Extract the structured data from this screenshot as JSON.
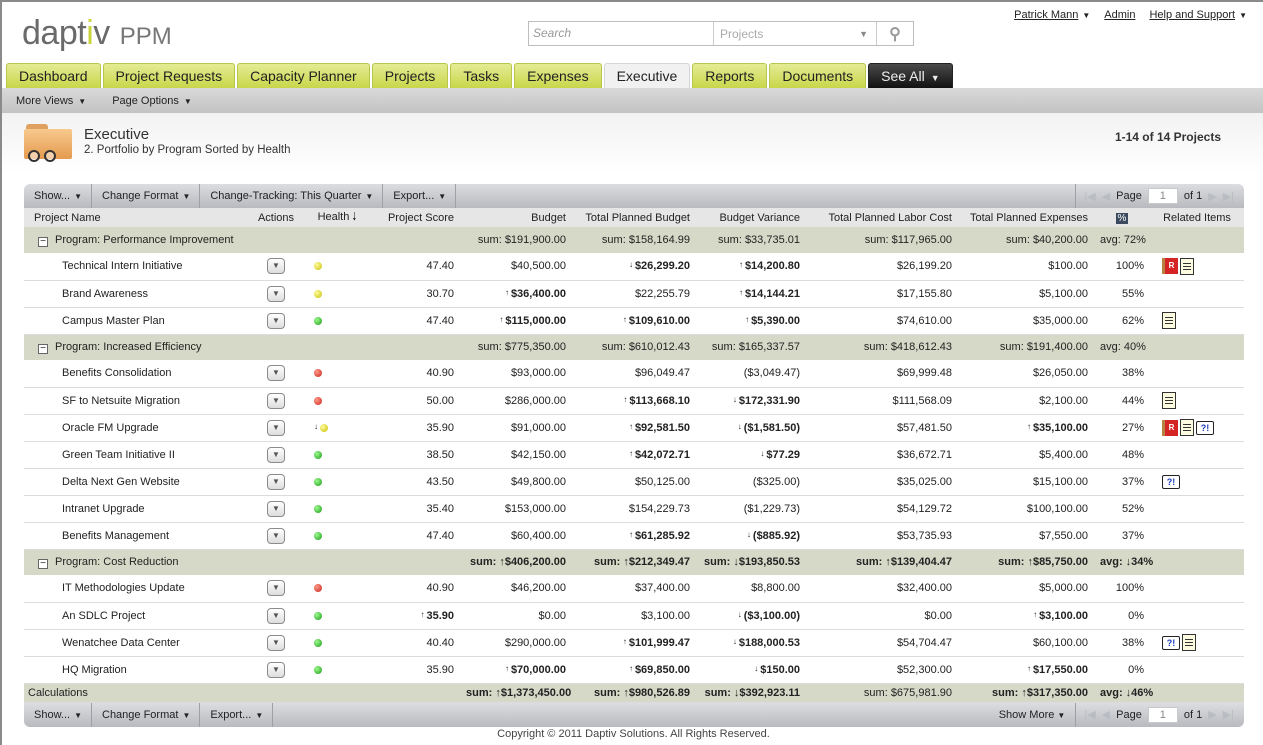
{
  "app": {
    "brand": "daptiv",
    "product": "PPM"
  },
  "search": {
    "placeholder": "Search",
    "scope": "Projects"
  },
  "toplinks": {
    "user": "Patrick Mann",
    "admin": "Admin",
    "help": "Help and Support"
  },
  "tabs": [
    {
      "label": "Dashboard"
    },
    {
      "label": "Project Requests"
    },
    {
      "label": "Capacity Planner"
    },
    {
      "label": "Projects"
    },
    {
      "label": "Tasks"
    },
    {
      "label": "Expenses"
    },
    {
      "label": "Executive",
      "active": true
    },
    {
      "label": "Reports"
    },
    {
      "label": "Documents"
    },
    {
      "label": "See All"
    }
  ],
  "subnav": {
    "more_views": "More Views",
    "page_options": "Page Options"
  },
  "page": {
    "title": "Executive",
    "subtitle": "2. Portfolio by Program Sorted by Health",
    "count": "1-14 of 14 Projects"
  },
  "toolbar": {
    "show": "Show...",
    "change_format": "Change Format",
    "change_tracking": "Change-Tracking: This Quarter",
    "export": "Export...",
    "show_more": "Show More",
    "page_label": "Page",
    "page_value": "1",
    "of_label": "of 1"
  },
  "columns": {
    "name": "Project Name",
    "actions": "Actions",
    "health": "Health",
    "score": "Project Score",
    "budget": "Budget",
    "tpb": "Total Planned Budget",
    "variance": "Budget Variance",
    "labor": "Total Planned Labor Cost",
    "expenses": "Total Planned Expenses",
    "pct": "%",
    "related": "Related Items"
  },
  "groups": [
    {
      "label": "Program: Performance Improvement",
      "budget": "sum: $191,900.00",
      "tpb": "sum: $158,164.99",
      "variance": "sum: $33,735.01",
      "labor": "sum: $117,965.00",
      "expenses": "sum: $40,200.00",
      "pct": "avg: 72%",
      "rows": [
        {
          "name": "Technical Intern Initiative",
          "health": "yellow",
          "score": "47.40",
          "budget": "$40,500.00",
          "tpb": "$26,299.20",
          "tpb_chg": "↓",
          "variance": "$14,200.80",
          "variance_chg": "↑",
          "labor": "$26,199.20",
          "expenses": "$100.00",
          "pct": "100%",
          "related": [
            "flag",
            "doc"
          ]
        },
        {
          "name": "Brand Awareness",
          "health": "yellow",
          "score": "30.70",
          "budget": "$36,400.00",
          "budget_chg": "↑",
          "tpb": "$22,255.79",
          "variance": "$14,144.21",
          "variance_chg": "↑",
          "labor": "$17,155.80",
          "expenses": "$5,100.00",
          "pct": "55%",
          "related": []
        },
        {
          "name": "Campus Master Plan",
          "health": "green",
          "score": "47.40",
          "budget": "$115,000.00",
          "budget_chg": "↑",
          "tpb": "$109,610.00",
          "tpb_chg": "↑",
          "variance": "$5,390.00",
          "variance_chg": "↑",
          "labor": "$74,610.00",
          "expenses": "$35,000.00",
          "pct": "62%",
          "related": [
            "doc"
          ]
        }
      ]
    },
    {
      "label": "Program: Increased Efficiency",
      "budget": "sum: $775,350.00",
      "tpb": "sum: $610,012.43",
      "variance": "sum: $165,337.57",
      "labor": "sum: $418,612.43",
      "expenses": "sum: $191,400.00",
      "pct": "avg: 40%",
      "rows": [
        {
          "name": "Benefits Consolidation",
          "health": "red",
          "score": "40.90",
          "budget": "$93,000.00",
          "tpb": "$96,049.47",
          "variance": "($3,049.47)",
          "labor": "$69,999.48",
          "expenses": "$26,050.00",
          "pct": "38%",
          "related": []
        },
        {
          "name": "SF to Netsuite Migration",
          "health": "red",
          "score": "50.00",
          "budget": "$286,000.00",
          "tpb": "$113,668.10",
          "tpb_chg": "↑",
          "variance": "$172,331.90",
          "variance_chg": "↓",
          "labor": "$111,568.09",
          "expenses": "$2,100.00",
          "pct": "44%",
          "related": [
            "doc"
          ]
        },
        {
          "name": "Oracle FM Upgrade",
          "health": "yellow",
          "health_chg": "↓",
          "score": "35.90",
          "budget": "$91,000.00",
          "tpb": "$92,581.50",
          "tpb_chg": "↑",
          "variance": "($1,581.50)",
          "variance_chg": "↓",
          "labor": "$57,481.50",
          "expenses": "$35,100.00",
          "expenses_chg": "↑",
          "pct": "27%",
          "related": [
            "flag",
            "doc",
            "note"
          ]
        },
        {
          "name": "Green Team Initiative II",
          "health": "green",
          "score": "38.50",
          "budget": "$42,150.00",
          "tpb": "$42,072.71",
          "tpb_chg": "↑",
          "variance": "$77.29",
          "variance_chg": "↓",
          "labor": "$36,672.71",
          "expenses": "$5,400.00",
          "pct": "48%",
          "related": []
        },
        {
          "name": "Delta Next Gen Website",
          "health": "green",
          "score": "43.50",
          "budget": "$49,800.00",
          "tpb": "$50,125.00",
          "variance": "($325.00)",
          "labor": "$35,025.00",
          "expenses": "$15,100.00",
          "pct": "37%",
          "related": [
            "note"
          ]
        },
        {
          "name": "Intranet Upgrade",
          "health": "green",
          "score": "35.40",
          "budget": "$153,000.00",
          "tpb": "$154,229.73",
          "variance": "($1,229.73)",
          "labor": "$54,129.72",
          "expenses": "$100,100.00",
          "pct": "52%",
          "related": []
        },
        {
          "name": "Benefits Management",
          "health": "green",
          "score": "47.40",
          "budget": "$60,400.00",
          "tpb": "$61,285.92",
          "tpb_chg": "↑",
          "variance": "($885.92)",
          "variance_chg": "↓",
          "labor": "$53,735.93",
          "expenses": "$7,550.00",
          "pct": "37%",
          "related": []
        }
      ]
    },
    {
      "label": "Program: Cost Reduction",
      "bold": true,
      "budget": "sum: ↑$406,200.00",
      "tpb": "sum: ↑$212,349.47",
      "variance": "sum: ↓$193,850.53",
      "labor": "sum: ↑$139,404.47",
      "expenses": "sum: ↑$85,750.00",
      "pct": "avg: ↓34%",
      "rows": [
        {
          "name": "IT Methodologies Update",
          "health": "red",
          "score": "40.90",
          "budget": "$46,200.00",
          "tpb": "$37,400.00",
          "variance": "$8,800.00",
          "labor": "$32,400.00",
          "expenses": "$5,000.00",
          "pct": "100%",
          "related": []
        },
        {
          "name": "An SDLC Project",
          "health": "green",
          "score": "35.90",
          "score_chg": "↑",
          "budget": "$0.00",
          "tpb": "$3,100.00",
          "variance": "($3,100.00)",
          "variance_chg": "↓",
          "labor": "$0.00",
          "expenses": "$3,100.00",
          "expenses_chg": "↑",
          "pct": "0%",
          "related": []
        },
        {
          "name": "Wenatchee Data Center",
          "health": "green",
          "score": "40.40",
          "budget": "$290,000.00",
          "tpb": "$101,999.47",
          "tpb_chg": "↑",
          "variance": "$188,000.53",
          "variance_chg": "↓",
          "labor": "$54,704.47",
          "expenses": "$60,100.00",
          "pct": "38%",
          "related": [
            "note",
            "doc"
          ]
        },
        {
          "name": "HQ Migration",
          "health": "green",
          "score": "35.90",
          "budget": "$70,000.00",
          "budget_chg": "↑",
          "tpb": "$69,850.00",
          "tpb_chg": "↑",
          "variance": "$150.00",
          "variance_chg": "↓",
          "labor": "$52,300.00",
          "expenses": "$17,550.00",
          "expenses_chg": "↑",
          "pct": "0%",
          "related": []
        }
      ]
    }
  ],
  "calculations": {
    "label": "Calculations",
    "budget": "sum: ↑$1,373,450.00",
    "tpb": "sum: ↑$980,526.89",
    "variance": "sum: ↓$392,923.11",
    "labor": "sum: $675,981.90",
    "expenses": "sum: ↑$317,350.00",
    "pct": "avg: ↓46%"
  },
  "footer": {
    "copyright": "Copyright © 2011 Daptiv Solutions. All Rights Reserved."
  }
}
